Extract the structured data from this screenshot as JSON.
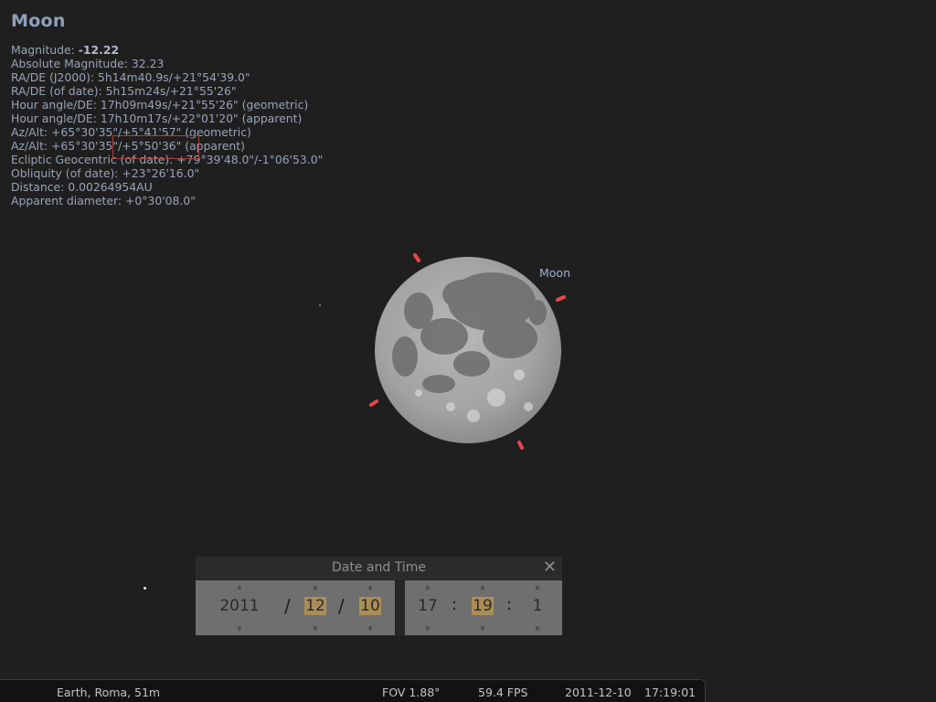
{
  "object_info": {
    "name": "Moon",
    "lines": [
      {
        "label": "Magnitude: ",
        "value": "-12.22",
        "bold": true
      },
      {
        "label": "Absolute Magnitude: ",
        "value": "32.23"
      },
      {
        "label": "RA/DE (J2000): ",
        "value": "5h14m40.9s/+21°54'39.0\""
      },
      {
        "label": "RA/DE (of date): ",
        "value": "5h15m24s/+21°55'26\""
      },
      {
        "label": "Hour angle/DE: ",
        "value": "17h09m49s/+21°55'26\" (geometric)"
      },
      {
        "label": "Hour angle/DE: ",
        "value": "17h10m17s/+22°01'20\" (apparent)"
      },
      {
        "label": "Az/Alt: ",
        "value": "+65°30'35\"/+5°41'57\" (geometric)"
      },
      {
        "label": "Az/Alt: ",
        "value": "+65°30'35\"/+5°50'36\" (apparent)"
      },
      {
        "label": "Ecliptic Geocentric (of date): ",
        "value": "+79°39'48.0\"/-1°06'53.0\""
      },
      {
        "label": "Obliquity (of date): ",
        "value": "+23°26'16.0\""
      },
      {
        "label": "Distance: ",
        "value": "0.00264954AU"
      },
      {
        "label": "Apparent diameter: ",
        "value": "+0°30'08.0\""
      }
    ]
  },
  "sky": {
    "moon_label": "Moon",
    "marker_color": "#e8474b"
  },
  "date_time_dialog": {
    "title": "Date and Time",
    "close_icon": "close-icon",
    "year": "2011",
    "month": "12",
    "day": "10",
    "hour": "17",
    "minute": "19",
    "second": "1",
    "date_separator": "/",
    "time_separator": ":"
  },
  "status_bar": {
    "location": "Earth, Roma, 51m",
    "fov": "FOV 1.88°",
    "fps": "59.4 FPS",
    "date": "2011-12-10",
    "time": "17:19:01"
  }
}
